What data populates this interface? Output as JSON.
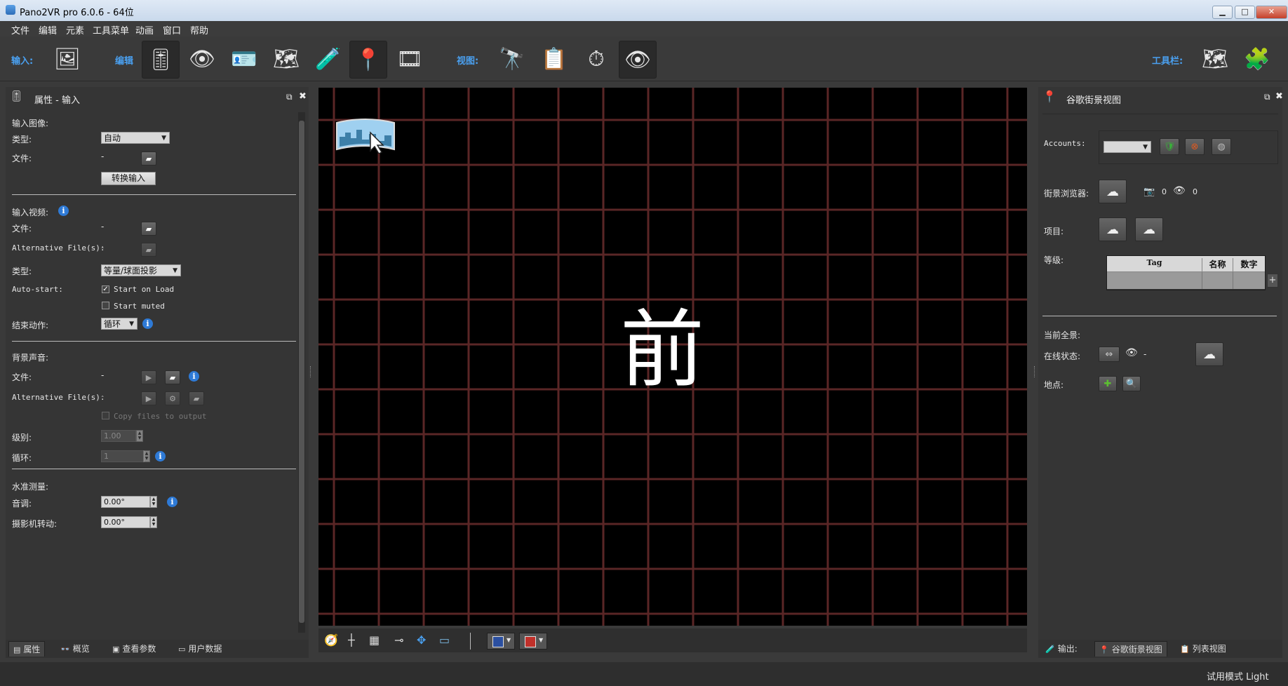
{
  "window": {
    "title": "Pano2VR pro 6.0.6 - 64位",
    "min": "▁",
    "max": "□",
    "close": "✕"
  },
  "menu": [
    "文件",
    "编辑",
    "元素",
    "工具菜单",
    "动画",
    "窗口",
    "帮助"
  ],
  "toolbar": {
    "input_label": "输入:",
    "edit_label": "编辑",
    "view_label": "视图:",
    "toolbars_label": "工具栏:"
  },
  "left_panel": {
    "title": "属性 - 输入",
    "input_image": {
      "section": "输入图像:",
      "type_label": "类型:",
      "type_value": "自动",
      "file_label": "文件:",
      "file_value": "-",
      "convert_button": "转换输入"
    },
    "input_video": {
      "section": "输入视频:",
      "file_label": "文件:",
      "file_value": "-",
      "alt_label": "Alternative File(s):",
      "alt_value": "-",
      "type_label": "类型:",
      "type_value": "等量/球面投影",
      "autostart_label": "Auto-start:",
      "start_on_load": "Start on Load",
      "start_muted": "Start muted",
      "end_action_label": "结束动作:",
      "end_action_value": "循环"
    },
    "bg_sound": {
      "section": "背景声音:",
      "file_label": "文件:",
      "file_value": "-",
      "alt_label": "Alternative File(s):",
      "alt_value": "-",
      "copy_files": "Copy files to output",
      "level_label": "级别:",
      "level_value": "1.00",
      "loop_label": "循环:",
      "loop_value": "1"
    },
    "leveling": {
      "section": "水准测量:",
      "pitch_label": "音调:",
      "pitch_value": "0.00°",
      "roll_label": "摄影机转动:",
      "roll_value": "0.00°"
    },
    "tabs": [
      "属性",
      "概览",
      "查看参数",
      "用户数据"
    ]
  },
  "viewport": {
    "face_label": "前"
  },
  "right_panel": {
    "title": "谷歌街景视图",
    "accounts_label": "Accounts:",
    "browser_label": "街景浏览器:",
    "photo_count": "0",
    "view_count": "0",
    "project_label": "项目:",
    "level_label": "等级:",
    "table_headers": [
      "Tag",
      "名称",
      "数字"
    ],
    "current_pano": "当前全景:",
    "online_label": "在线状态:",
    "online_value": "-",
    "location_label": "地点:",
    "tabs": [
      "输出:",
      "谷歌街景视图",
      "列表视图"
    ]
  },
  "status": {
    "mode": "试用模式 Light"
  },
  "colors": {
    "accent": "#4aa0f0",
    "grid": "#5a2626",
    "info": "#2e7ad6"
  }
}
